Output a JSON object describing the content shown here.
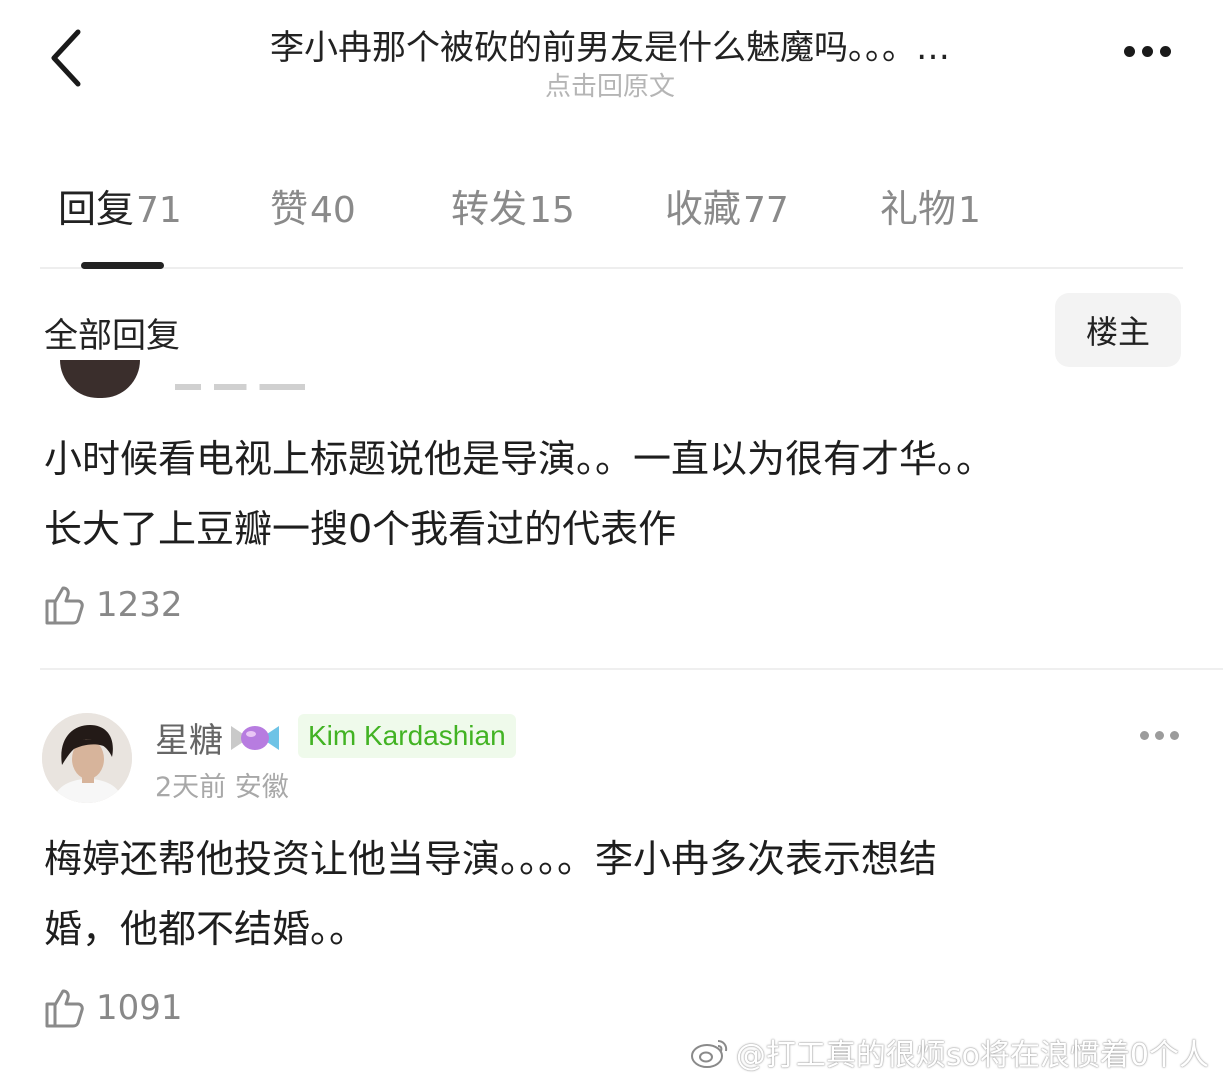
{
  "header": {
    "title": "李小冉那个被砍的前男友是什么魅魔吗。。。…",
    "subtitle": "点击回原文"
  },
  "tabs": [
    {
      "label": "回复",
      "count": "71"
    },
    {
      "label": "赞",
      "count": "40"
    },
    {
      "label": "转发",
      "count": "15"
    },
    {
      "label": "收藏",
      "count": "77"
    },
    {
      "label": "礼物",
      "count": "1"
    }
  ],
  "section": {
    "title": "全部回复",
    "op_filter": "楼主"
  },
  "comments": [
    {
      "text_lines": [
        "小时候看电视上标题说他是导演。。一直以为很有才华。。",
        "长大了上豆瓣一搜0个我看过的代表作"
      ],
      "likes": "1232"
    },
    {
      "username": "星糖",
      "badge": "Kim Kardashian",
      "meta": "2天前 安徽",
      "text_lines": [
        "梅婷还帮他投资让他当导演。。。。李小冉多次表示想结",
        "婚，他都不结婚。。"
      ],
      "likes": "1091"
    }
  ],
  "watermark": "@打工真的很烦so将在浪惯着0个人",
  "icons": {
    "back": "chevron-left-icon",
    "more": "more-icon",
    "like": "thumbs-up-icon",
    "candy": "candy-icon",
    "weibo": "weibo-logo-icon"
  },
  "colors": {
    "badge_text": "#42b323",
    "badge_bg": "#effaeb",
    "muted": "#8a8a8a"
  }
}
